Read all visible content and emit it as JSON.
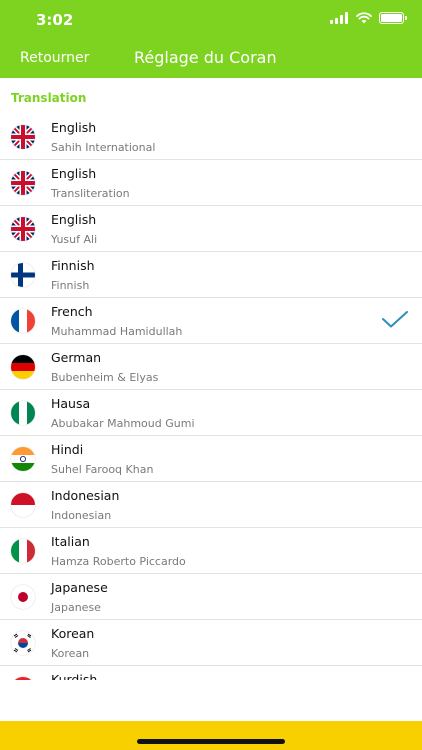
{
  "status_bar": {
    "time": "3:02"
  },
  "nav": {
    "back_label": "Retourner",
    "title": "Réglage du Coran"
  },
  "section": {
    "title": "Translation"
  },
  "colors": {
    "header_green": "#7ed321",
    "bottom_yellow": "#f8d000",
    "check_blue": "#2a8fbd"
  },
  "translations": [
    {
      "language": "English",
      "translator": "Sahih International",
      "flag": "uk-flag-icon",
      "selected": false
    },
    {
      "language": "English",
      "translator": "Transliteration",
      "flag": "uk-flag-icon",
      "selected": false
    },
    {
      "language": "English",
      "translator": "Yusuf Ali",
      "flag": "uk-flag-icon",
      "selected": false
    },
    {
      "language": "Finnish",
      "translator": "Finnish",
      "flag": "finland-flag-icon",
      "selected": false
    },
    {
      "language": "French",
      "translator": "Muhammad Hamidullah",
      "flag": "france-flag-icon",
      "selected": true
    },
    {
      "language": "German",
      "translator": "Bubenheim & Elyas",
      "flag": "germany-flag-icon",
      "selected": false
    },
    {
      "language": "Hausa",
      "translator": "Abubakar Mahmoud Gumi",
      "flag": "nigeria-flag-icon",
      "selected": false
    },
    {
      "language": "Hindi",
      "translator": "Suhel Farooq Khan",
      "flag": "india-flag-icon",
      "selected": false
    },
    {
      "language": "Indonesian",
      "translator": "Indonesian",
      "flag": "indonesia-flag-icon",
      "selected": false
    },
    {
      "language": "Italian",
      "translator": "Hamza Roberto Piccardo",
      "flag": "italy-flag-icon",
      "selected": false
    },
    {
      "language": "Japanese",
      "translator": "Japanese",
      "flag": "japan-flag-icon",
      "selected": false
    },
    {
      "language": "Korean",
      "translator": "Korean",
      "flag": "korea-flag-icon",
      "selected": false
    },
    {
      "language": "Kurdish",
      "translator": "",
      "flag": "kurdistan-flag-icon",
      "selected": false
    }
  ]
}
